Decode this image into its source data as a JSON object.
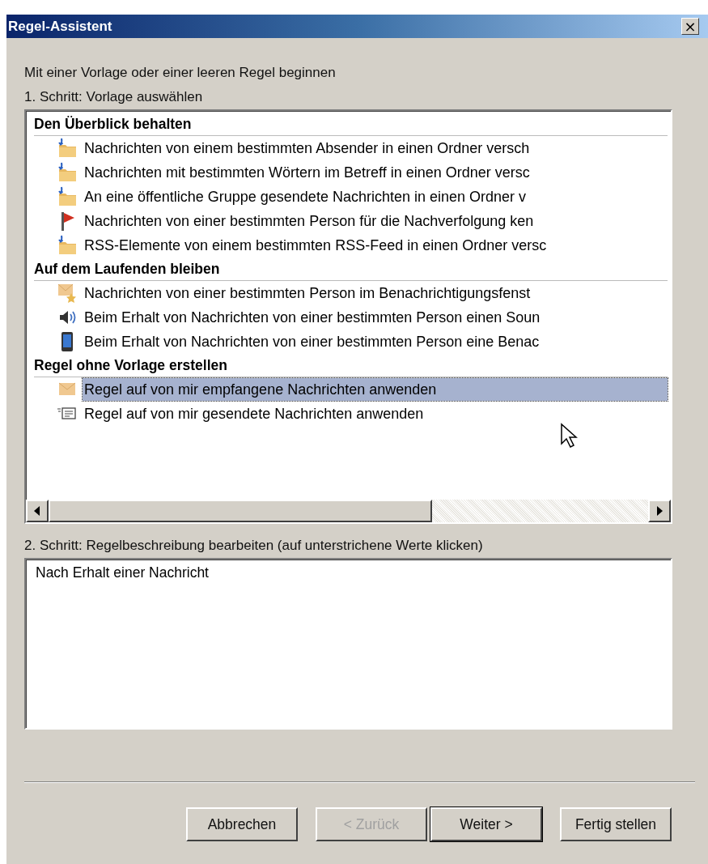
{
  "window": {
    "title": "Regel-Assistent",
    "close": "×"
  },
  "intro": "Mit einer Vorlage oder einer leeren Regel beginnen",
  "step1_label": "1. Schritt: Vorlage auswählen",
  "groups": [
    {
      "heading": "Den Überblick behalten",
      "items": [
        {
          "kind": "folder-move",
          "label": "Nachrichten von einem bestimmten Absender in einen Ordner versch",
          "selected": false
        },
        {
          "kind": "folder-move",
          "label": "Nachrichten mit bestimmten Wörtern im Betreff in einen Ordner versc",
          "selected": false
        },
        {
          "kind": "folder-move",
          "label": "An eine öffentliche Gruppe gesendete Nachrichten in einen Ordner v",
          "selected": false
        },
        {
          "kind": "flag",
          "label": "Nachrichten von einer bestimmten Person für die Nachverfolgung ken",
          "selected": false
        },
        {
          "kind": "folder-move",
          "label": "RSS-Elemente von einem bestimmten RSS-Feed in einen Ordner versc",
          "selected": false
        }
      ]
    },
    {
      "heading": "Auf dem Laufenden bleiben",
      "items": [
        {
          "kind": "mail-star",
          "label": "Nachrichten von einer bestimmten Person im Benachrichtigungsfenst",
          "selected": false
        },
        {
          "kind": "speaker",
          "label": "Beim Erhalt von Nachrichten von einer bestimmten Person einen Soun",
          "selected": false
        },
        {
          "kind": "phone",
          "label": "Beim Erhalt von Nachrichten von einer bestimmten Person eine Benac",
          "selected": false
        }
      ]
    },
    {
      "heading": "Regel ohne Vorlage erstellen",
      "items": [
        {
          "kind": "envelope",
          "label": "Regel auf von mir empfangene Nachrichten anwenden",
          "selected": true
        },
        {
          "kind": "sent",
          "label": "Regel auf von mir gesendete Nachrichten anwenden",
          "selected": false
        }
      ]
    }
  ],
  "step2_label": "2. Schritt: Regelbeschreibung bearbeiten (auf unterstrichene Werte klicken)",
  "description": "Nach Erhalt einer Nachricht",
  "buttons": [
    {
      "label": "Abbrechen",
      "disabled": false,
      "default": false
    },
    {
      "label": "< Zurück",
      "disabled": true,
      "default": false
    },
    {
      "label": "Weiter >",
      "disabled": false,
      "default": true
    },
    {
      "label": "Fertig stellen",
      "disabled": false,
      "default": false
    }
  ]
}
